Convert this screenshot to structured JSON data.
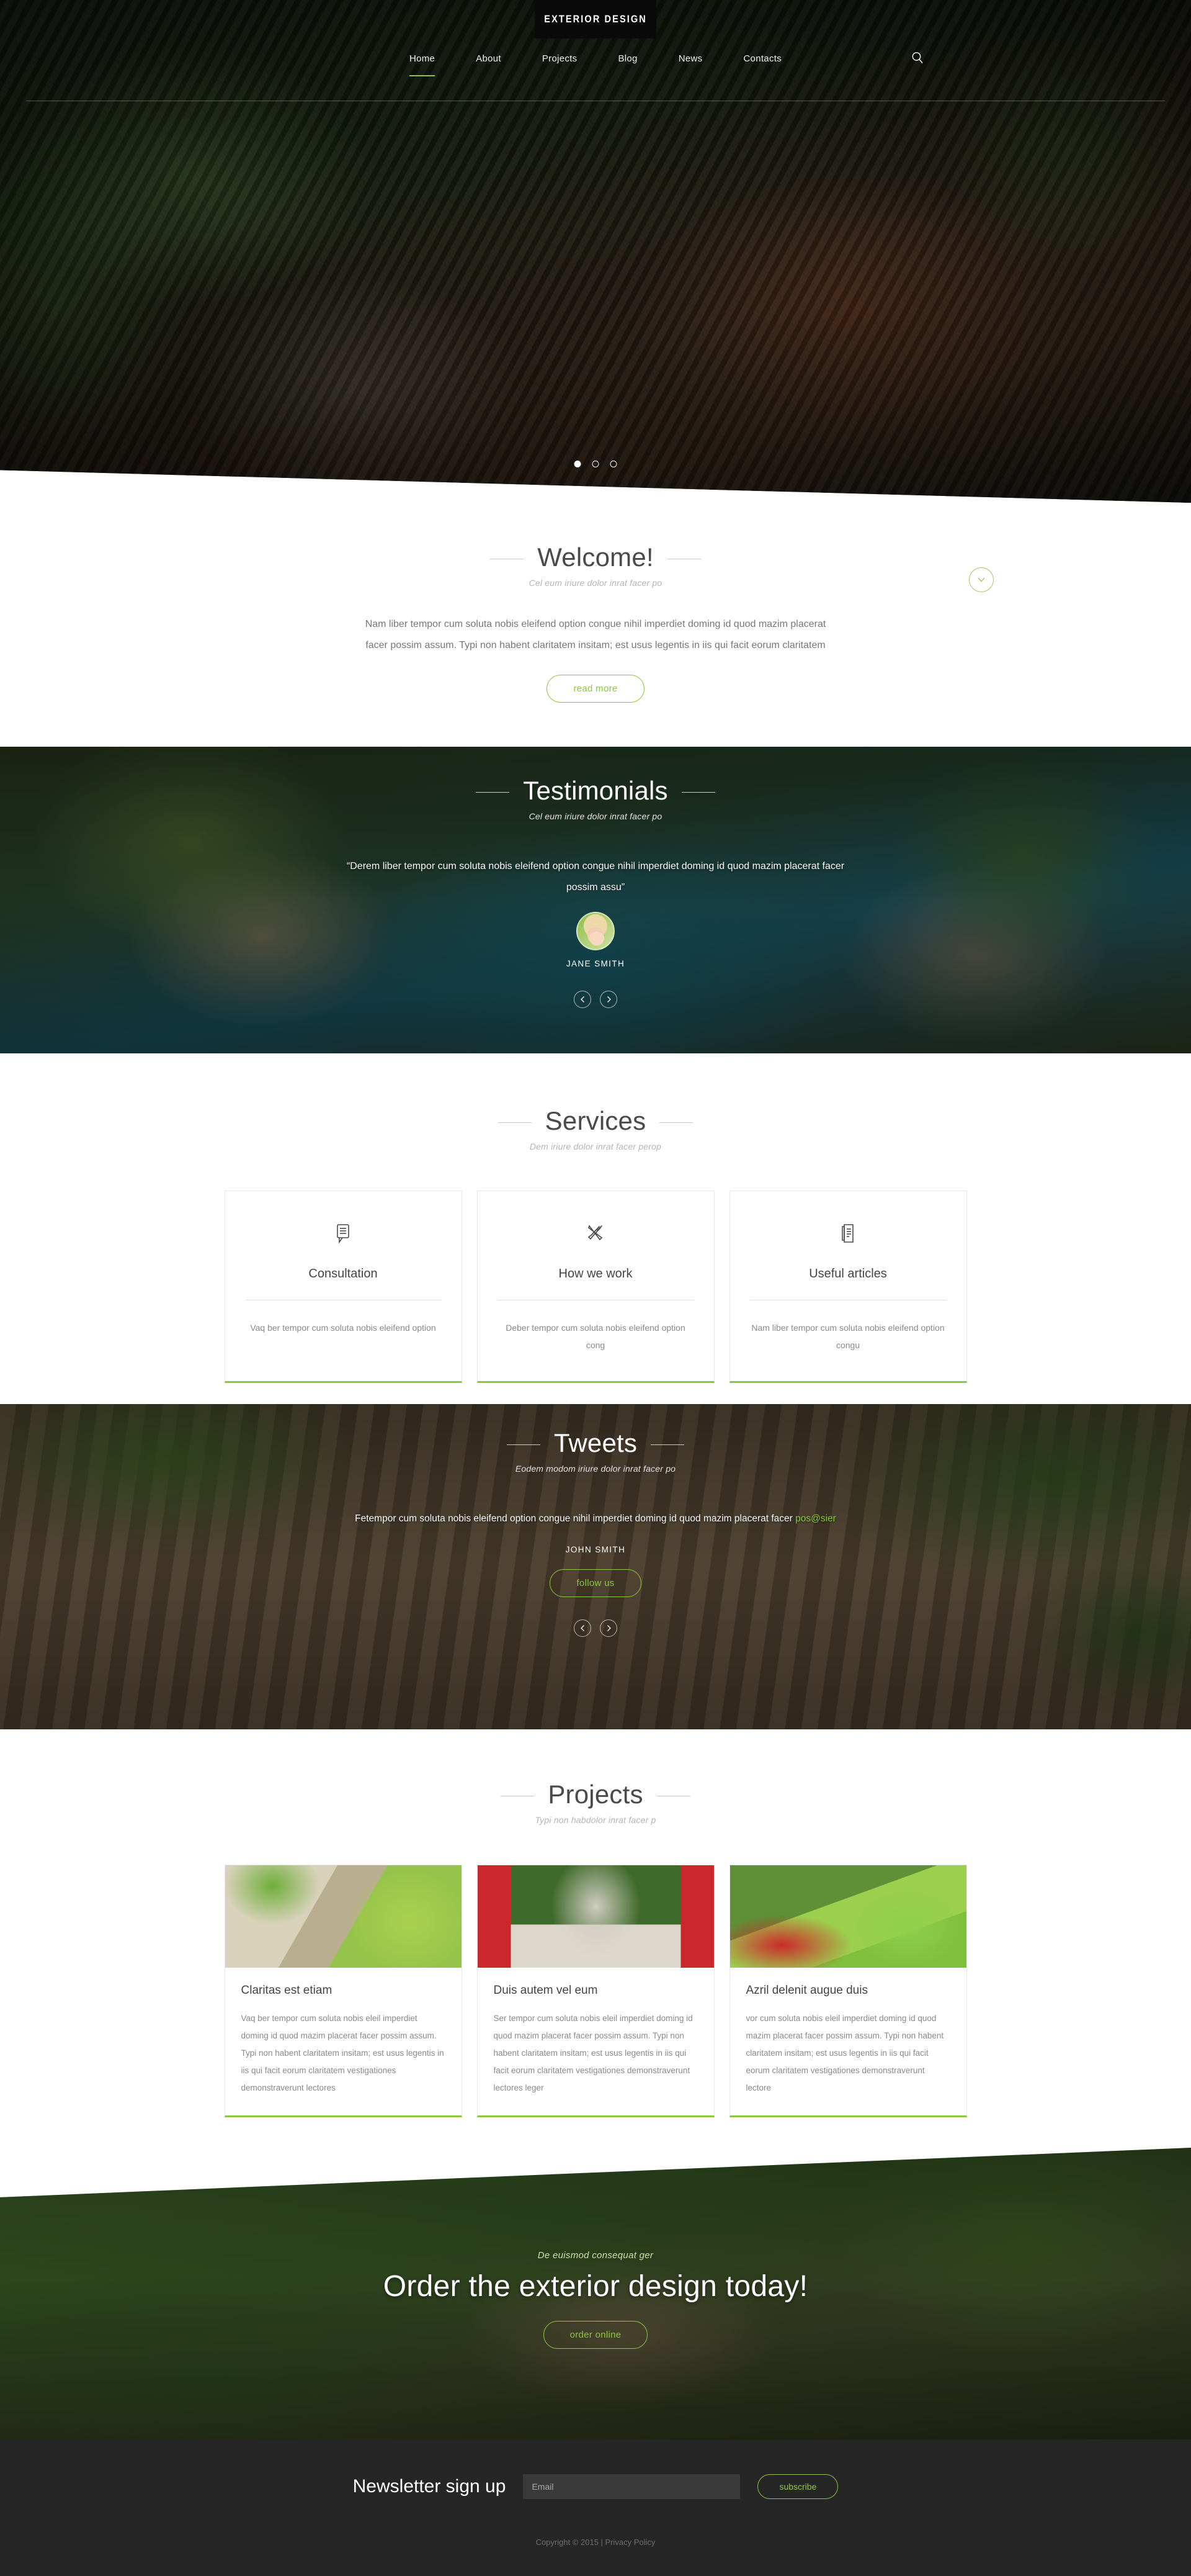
{
  "brand": {
    "name": "EXTERIOR DESIGN"
  },
  "colors": {
    "accent": "#8dc63f",
    "footer_bg": "#262626",
    "heading": "#4a4a4a"
  },
  "nav": {
    "items": [
      {
        "label": "Home",
        "active": true
      },
      {
        "label": "About",
        "active": false
      },
      {
        "label": "Projects",
        "active": false
      },
      {
        "label": "Blog",
        "active": false
      },
      {
        "label": "News",
        "active": false
      },
      {
        "label": "Contacts",
        "active": false
      }
    ],
    "search_icon": "search-icon"
  },
  "hero": {
    "slides_count": 3,
    "active_slide": 1
  },
  "welcome": {
    "title": "Welcome!",
    "subtitle": "Cel eum iriure dolor inrat facer po",
    "body": "Nam liber tempor cum soluta nobis eleifend option congue nihil imperdiet doming id quod mazim placerat facer possim assum. Typi non habent claritatem insitam; est usus legentis in iis qui facit eorum claritatem",
    "button": "read more",
    "scroll_icon": "chevron-down-icon"
  },
  "testimonials": {
    "title": "Testimonials",
    "subtitle": "Cel eum iriure dolor inrat facer po",
    "quote": "“Derem liber tempor cum soluta nobis eleifend option congue nihil imperdiet doming id quod mazim placerat facer possim assu”",
    "author": "JANE SMITH",
    "prev_icon": "chevron-left-icon",
    "next_icon": "chevron-right-icon"
  },
  "services": {
    "title": "Services",
    "subtitle": "Dem iriure dolor inrat facer perop",
    "cards": [
      {
        "icon": "speech-bubble-icon",
        "title": "Consultation",
        "text": "Vaq ber tempor cum soluta nobis eleifend option"
      },
      {
        "icon": "tools-icon",
        "title": "How we work",
        "text": "Deber tempor cum soluta nobis eleifend option cong"
      },
      {
        "icon": "document-icon",
        "title": "Useful articles",
        "text": "Nam liber tempor cum soluta nobis eleifend option congu"
      }
    ]
  },
  "tweets": {
    "title": "Tweets",
    "subtitle": "Eodem modom iriure dolor inrat facer po",
    "text_before_link": "Fetempor cum soluta nobis eleifend option congue nihil imperdiet doming id quod mazim placerat facer ",
    "link": "pos@sier",
    "author": "JOHN SMITH",
    "button": "follow us",
    "prev_icon": "chevron-left-icon",
    "next_icon": "chevron-right-icon"
  },
  "projects": {
    "title": "Projects",
    "subtitle": "Typi non habdolor inrat facer p",
    "cards": [
      {
        "image": "garden-stone-steps",
        "title": "Claritas est etiam",
        "text": "Vaq ber tempor cum soluta nobis eleil imperdiet doming id quod mazim placerat facer possim assum. Typi non habent claritatem insitam; est usus legentis in iis qui facit eorum claritatem vestigationes demonstraverunt lectores"
      },
      {
        "image": "red-garden-bridge",
        "title": "Duis autem vel eum",
        "text": "Ser tempor cum soluta nobis eleil imperdiet doming id quod mazim placerat facer possim assum. Typi non habent claritatem insitam; est usus legentis in iis qui facit eorum claritatem vestigationes demonstraverunt lectores leger"
      },
      {
        "image": "flower-garden-lawn",
        "title": "Azril delenit augue duis",
        "text": "vor cum soluta nobis eleil imperdiet doming id quod mazim placerat facer possim assum. Typi non habent claritatem insitam; est usus legentis in iis qui facit eorum claritatem vestigationes demonstraverunt lectore"
      }
    ]
  },
  "cta": {
    "subtitle": "De euismod consequat ger",
    "title": "Order the exterior design today!",
    "button": "order online"
  },
  "footer": {
    "newsletter_title": "Newsletter sign up",
    "email_placeholder": "Email",
    "email_value": "",
    "subscribe_button": "subscribe",
    "copyright": "Copyright © 2015 | Privacy Policy"
  }
}
